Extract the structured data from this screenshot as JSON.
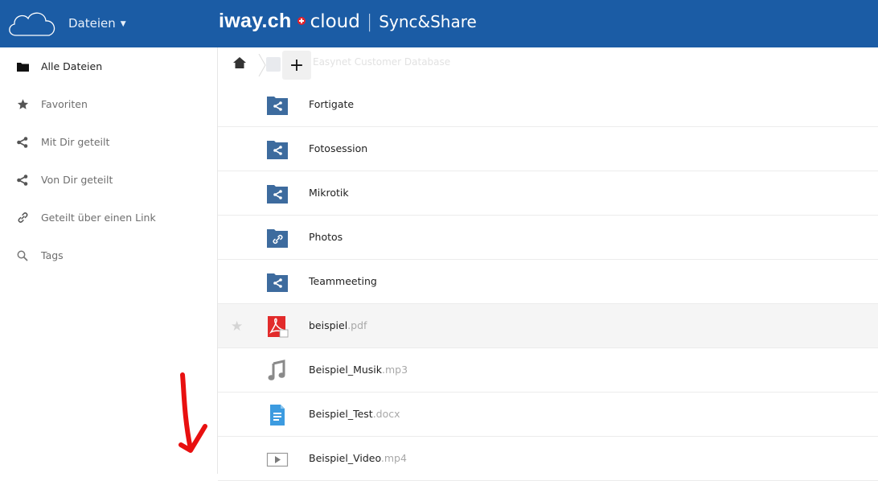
{
  "header": {
    "app_menu_label": "Dateien",
    "brand_name": "iway.ch",
    "brand_cloud": "cloud",
    "brand_separator": "|",
    "brand_product": "Sync&Share",
    "colors": {
      "header_bg": "#1b5ca5",
      "swiss_red": "#e3232c"
    }
  },
  "sidebar": {
    "items": [
      {
        "label": "Alle Dateien",
        "icon": "folder-icon",
        "active": true
      },
      {
        "label": "Favoriten",
        "icon": "star-icon",
        "active": false
      },
      {
        "label": "Mit Dir geteilt",
        "icon": "share-icon",
        "active": false
      },
      {
        "label": "Von Dir geteilt",
        "icon": "share-icon",
        "active": false
      },
      {
        "label": "Geteilt über einen Link",
        "icon": "link-icon",
        "active": false
      },
      {
        "label": "Tags",
        "icon": "search-icon",
        "active": false
      }
    ]
  },
  "breadcrumb": {
    "current": "Easynet Customer Database",
    "new_button_label": "+"
  },
  "files": [
    {
      "name": "Fortigate",
      "ext": "",
      "icon": "shared-folder-icon"
    },
    {
      "name": "Fotosession",
      "ext": "",
      "icon": "shared-folder-icon"
    },
    {
      "name": "Mikrotik",
      "ext": "",
      "icon": "shared-folder-icon"
    },
    {
      "name": "Photos",
      "ext": "",
      "icon": "link-folder-icon"
    },
    {
      "name": "Teammeeting",
      "ext": "",
      "icon": "shared-folder-icon"
    },
    {
      "name": "beispiel",
      "ext": ".pdf",
      "icon": "pdf-file-icon"
    },
    {
      "name": "Beispiel_Musik",
      "ext": ".mp3",
      "icon": "music-file-icon"
    },
    {
      "name": "Beispiel_Test",
      "ext": ".docx",
      "icon": "document-file-icon"
    },
    {
      "name": "Beispiel_Video",
      "ext": ".mp4",
      "icon": "video-file-icon"
    }
  ]
}
